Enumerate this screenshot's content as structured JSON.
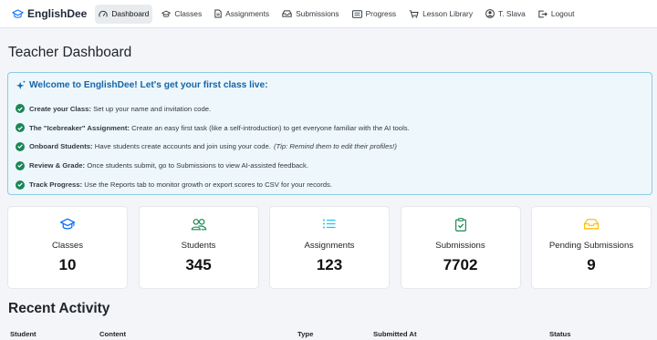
{
  "nav": {
    "brand": "EnglishDee",
    "items": [
      {
        "label": "Dashboard",
        "icon": "speedometer-icon",
        "active": true
      },
      {
        "label": "Classes",
        "icon": "graduation-cap-icon"
      },
      {
        "label": "Assignments",
        "icon": "file-icon"
      },
      {
        "label": "Submissions",
        "icon": "inbox-icon"
      },
      {
        "label": "Progress",
        "icon": "card-list-icon"
      },
      {
        "label": "Lesson Library",
        "icon": "cart-icon"
      },
      {
        "label": "T. Slava",
        "icon": "user-circle-icon"
      },
      {
        "label": "Logout",
        "icon": "logout-icon"
      }
    ]
  },
  "page_title": "Teacher Dashboard",
  "welcome": {
    "title": "Welcome to EnglishDee! Let's get your first class live:",
    "steps": [
      {
        "title": "Create your Class:",
        "text": "Set up your name and invitation code.",
        "tip": ""
      },
      {
        "title": "The \"Icebreaker\" Assignment:",
        "text": "Create an easy first task (like a self-introduction) to get everyone familiar with the AI tools.",
        "tip": ""
      },
      {
        "title": "Onboard Students:",
        "text": "Have students create accounts and join using your code.",
        "tip": "(Tip: Remind them to edit their profiles!)"
      },
      {
        "title": "Review & Grade:",
        "text": "Once students submit, go to Submissions to view AI-assisted feedback.",
        "tip": ""
      },
      {
        "title": "Track Progress:",
        "text": "Use the Reports tab to monitor growth or export scores to CSV for your records.",
        "tip": ""
      }
    ]
  },
  "stats": [
    {
      "label": "Classes",
      "value": "10",
      "icon": "graduation-cap-icon",
      "color": "#0d6efd"
    },
    {
      "label": "Students",
      "value": "345",
      "icon": "people-icon",
      "color": "#198754"
    },
    {
      "label": "Assignments",
      "value": "123",
      "icon": "list-icon",
      "color": "#0dcaf0"
    },
    {
      "label": "Submissions",
      "value": "7702",
      "icon": "clipboard-check-icon",
      "color": "#198754"
    },
    {
      "label": "Pending Submissions",
      "value": "9",
      "icon": "inbox-icon",
      "color": "#ffc107"
    }
  ],
  "recent": {
    "title": "Recent Activity",
    "columns": [
      "Student",
      "Content",
      "Type",
      "Submitted At",
      "Status"
    ]
  },
  "colors": {
    "accent": "#1565a8",
    "check_green": "#198754",
    "welcome_bg": "#eef7fc",
    "welcome_border": "#8ecae6"
  }
}
